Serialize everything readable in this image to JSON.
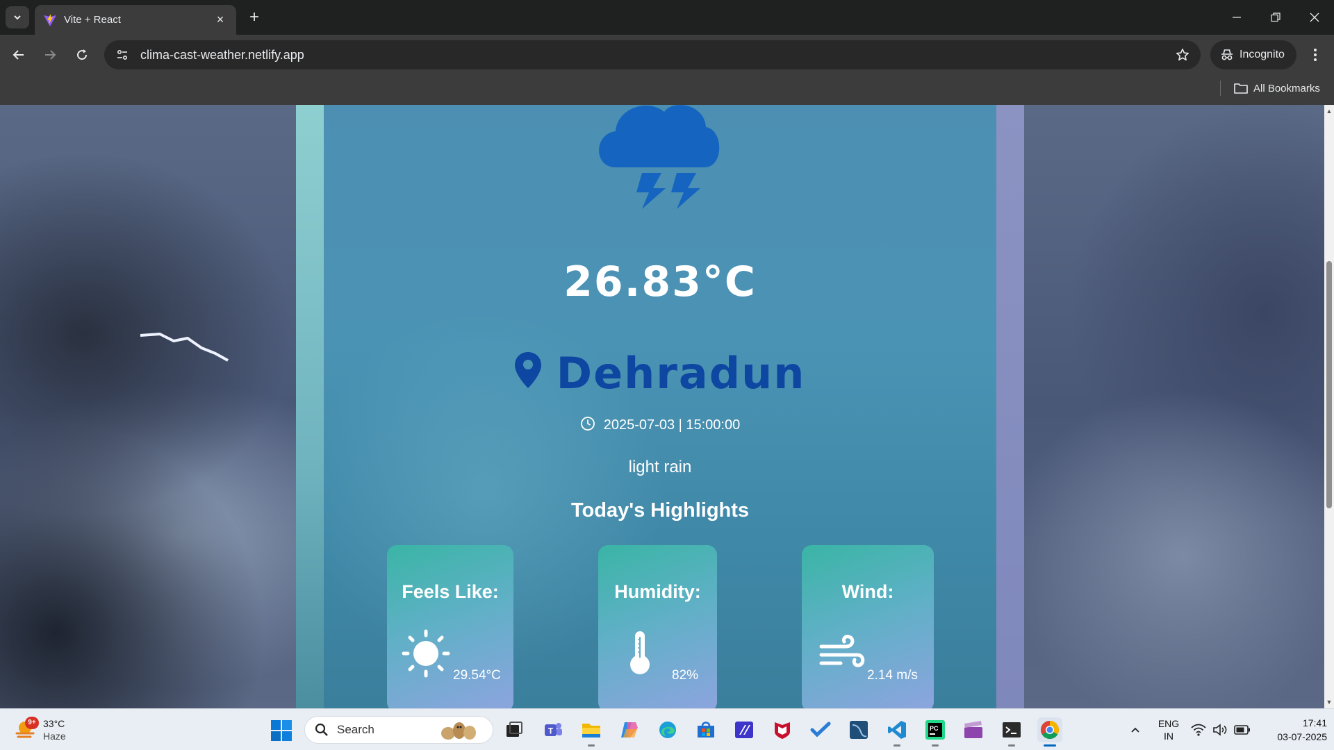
{
  "browser": {
    "tab_title": "Vite + React",
    "url": "clima-cast-weather.netlify.app",
    "incognito_label": "Incognito",
    "all_bookmarks_label": "All Bookmarks"
  },
  "weather": {
    "temperature": "26.83°C",
    "city": "Dehradun",
    "datetime": "2025-07-03 | 15:00:00",
    "description": "light rain",
    "highlights_title": "Today's Highlights",
    "highlights": [
      {
        "label": "Feels Like:",
        "value": "29.54°C",
        "icon": "sun-icon"
      },
      {
        "label": "Humidity:",
        "value": "82%",
        "icon": "thermometer-icon"
      },
      {
        "label": "Wind:",
        "value": "2.14 m/s",
        "icon": "wind-icon"
      }
    ],
    "colors": {
      "card": "#4b93b4",
      "city": "#0d47a1",
      "icon_blue": "#1565c0",
      "highlight_start": "#3ab5a5",
      "highlight_end": "#8da4df"
    }
  },
  "taskbar": {
    "weather_temp": "33°C",
    "weather_condition": "Haze",
    "weather_badge": "9+",
    "search_placeholder": "Search",
    "lang_line1": "ENG",
    "lang_line2": "IN",
    "time": "17:41",
    "date": "03-07-2025",
    "apps": [
      "file-explorer-icon",
      "teams-icon",
      "folder-icon",
      "copilot-icon",
      "edge-icon",
      "store-icon",
      "app-icon",
      "mcafee-icon",
      "todo-icon",
      "mysql-workbench-icon",
      "vscode-icon",
      "pycharm-icon",
      "clapper-icon",
      "terminal-icon",
      "chrome-icon"
    ]
  }
}
